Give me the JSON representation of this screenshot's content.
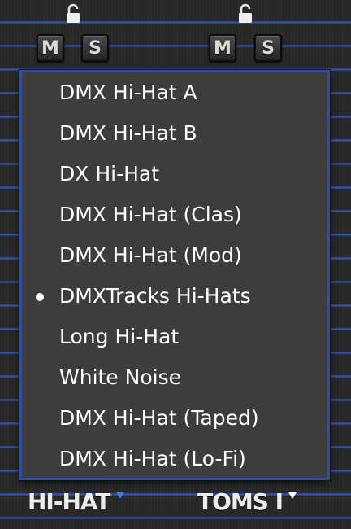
{
  "strips": [
    {
      "mute_label": "M",
      "solo_label": "S",
      "lock_icon": "padlock-open-icon"
    },
    {
      "mute_label": "M",
      "solo_label": "S",
      "lock_icon": "padlock-open-icon"
    }
  ],
  "menu": {
    "items": [
      {
        "label": "DMX Hi-Hat A",
        "selected": false
      },
      {
        "label": "DMX Hi-Hat B",
        "selected": false
      },
      {
        "label": "DX Hi-Hat",
        "selected": false
      },
      {
        "label": "DMX Hi-Hat (Clas)",
        "selected": false
      },
      {
        "label": "DMX Hi-Hat (Mod)",
        "selected": false
      },
      {
        "label": "DMXTracks Hi-Hats",
        "selected": true
      },
      {
        "label": "Long Hi-Hat",
        "selected": false
      },
      {
        "label": "White Noise",
        "selected": false
      },
      {
        "label": "DMX Hi-Hat (Taped)",
        "selected": false
      },
      {
        "label": "DMX Hi-Hat (Lo-Fi)",
        "selected": false
      }
    ]
  },
  "channels": {
    "left": {
      "name": "HI-HAT",
      "arrow_color": "#4a78d8",
      "icon": "dropdown-arrow-icon"
    },
    "right": {
      "name": "TOMS I",
      "arrow_color": "#ffffff",
      "icon": "dropdown-arrow-icon"
    }
  },
  "colors": {
    "accent_blue": "#2f4f9e",
    "menu_bg": "#3d3d3d",
    "text": "#ffffff"
  }
}
